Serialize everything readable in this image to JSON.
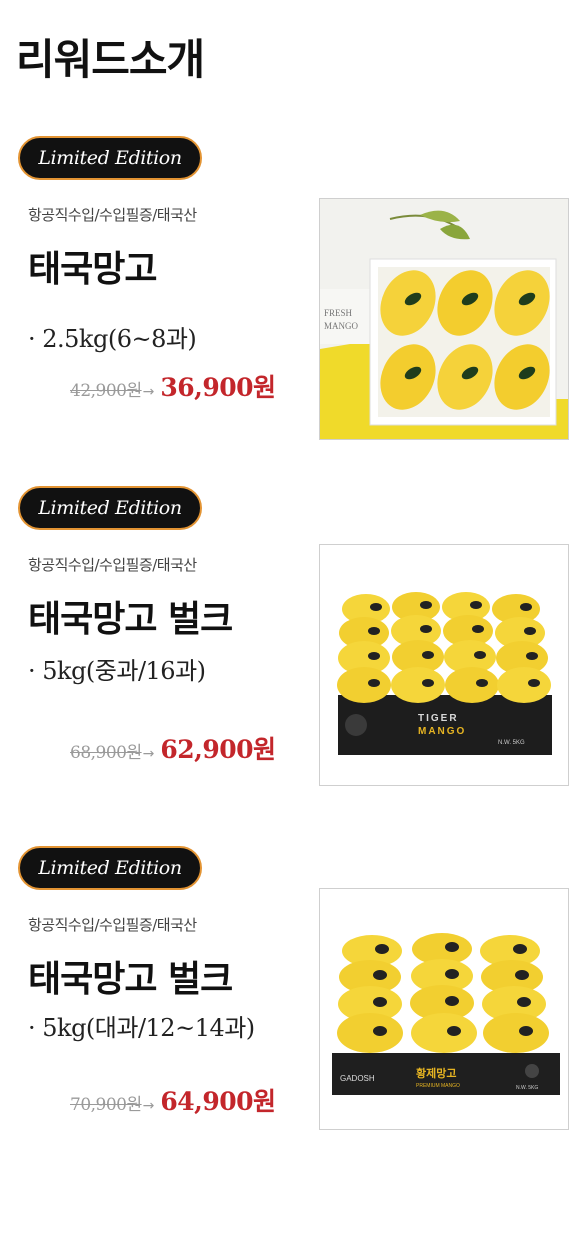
{
  "page": {
    "title": "리워드소개"
  },
  "products": [
    {
      "badge": "Limited Edition",
      "meta": "항공직수입/수입필증/태국산",
      "name": "태국망고",
      "spec": "· 2.5kg(6~8과)",
      "old_price": "42,900원",
      "new_price": "36,900원",
      "photo_text": [
        "FRESH",
        "MANGO"
      ]
    },
    {
      "badge": "Limited Edition",
      "meta": "항공직수입/수입필증/태국산",
      "name": "태국망고 벌크",
      "spec": "· 5kg(중과/16과)",
      "old_price": "68,900원",
      "new_price": "62,900원",
      "photo_text": [
        "TIGER",
        "MANGO",
        "N.W. 5KG"
      ]
    },
    {
      "badge": "Limited Edition",
      "meta": "항공직수입/수입필증/태국산",
      "name": "태국망고 벌크",
      "spec": "· 5kg(대과/12~14과)",
      "old_price": "70,900원",
      "new_price": "64,900원",
      "photo_text": [
        "GADOSH",
        "황제망고",
        "PREMIUM MANGO",
        "N.W. 5KG"
      ]
    }
  ],
  "colors": {
    "accent_red": "#c3262b",
    "badge_border": "#e39433",
    "mango": "#f5d742"
  }
}
